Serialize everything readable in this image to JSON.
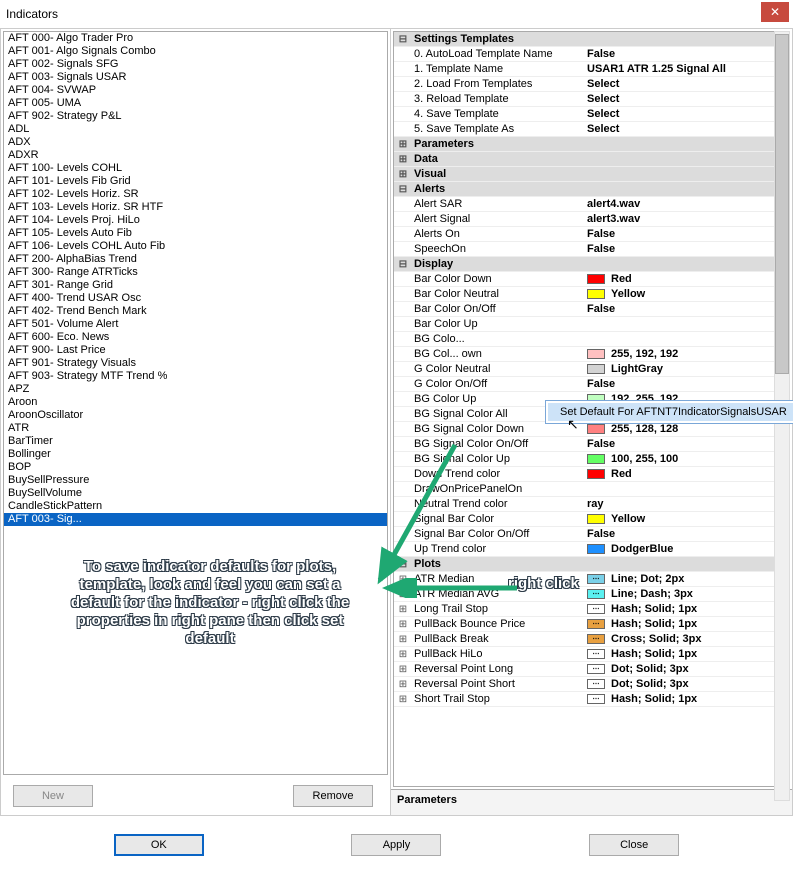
{
  "window": {
    "title": "Indicators",
    "close": "✕"
  },
  "indicators": [
    "AFT 000- Algo Trader Pro",
    "AFT 001- Algo Signals Combo",
    "AFT 002- Signals SFG",
    "AFT 003- Signals USAR",
    "AFT 004- SVWAP",
    "AFT 005- UMA",
    "AFT 902- Strategy P&L",
    "ADL",
    "ADX",
    "ADXR",
    "AFT 100- Levels COHL",
    "AFT 101- Levels Fib Grid",
    "AFT 102- Levels Horiz. SR",
    "AFT 103- Levels Horiz. SR HTF",
    "AFT 104- Levels Proj. HiLo",
    "AFT 105- Levels Auto Fib",
    "AFT 106- Levels COHL Auto Fib",
    "AFT 200- AlphaBias Trend",
    "AFT 300- Range ATRTicks",
    "AFT 301- Range Grid",
    "AFT 400- Trend USAR Osc",
    "AFT 402- Trend Bench Mark",
    "AFT 501- Volume Alert",
    "AFT 600- Eco. News",
    "AFT 900- Last Price",
    "AFT 901- Strategy Visuals",
    "AFT 903- Strategy MTF Trend %",
    "APZ",
    "Aroon",
    "AroonOscillator",
    "ATR",
    "BarTimer",
    "Bollinger",
    "BOP",
    "BuySellPressure",
    "BuySellVolume",
    "CandleStickPattern"
  ],
  "selected_indicator": "AFT 003- Sig...",
  "buttons": {
    "new": "New",
    "remove": "Remove",
    "ok": "OK",
    "apply": "Apply",
    "close": "Close"
  },
  "categories": {
    "settings_templates": "Settings Templates",
    "parameters": "Parameters",
    "data": "Data",
    "visual": "Visual",
    "alerts": "Alerts",
    "display": "Display",
    "plots": "Plots"
  },
  "templates": [
    {
      "label": "0. AutoLoad Template Name",
      "value": "False"
    },
    {
      "label": "1. Template Name",
      "value": "USAR1 ATR 1.25 Signal All"
    },
    {
      "label": "2. Load From Templates",
      "value": "Select"
    },
    {
      "label": "3. Reload Template",
      "value": "Select"
    },
    {
      "label": "4. Save Template",
      "value": "Select"
    },
    {
      "label": "5. Save Template As",
      "value": "Select"
    }
  ],
  "alerts": [
    {
      "label": "Alert SAR",
      "value": "alert4.wav"
    },
    {
      "label": "Alert Signal",
      "value": "alert3.wav"
    },
    {
      "label": "Alerts On",
      "value": "False"
    },
    {
      "label": "SpeechOn",
      "value": "False"
    }
  ],
  "display": [
    {
      "label": "Bar Color Down",
      "value": "Red",
      "swatch": "#ff0000"
    },
    {
      "label": "Bar Color Neutral",
      "value": "Yellow",
      "swatch": "#ffff00"
    },
    {
      "label": "Bar Color On/Off",
      "value": "False"
    },
    {
      "label": "Bar Color Up",
      "value": ""
    },
    {
      "label": "BG Colo...",
      "value": ""
    },
    {
      "label": "BG Col... own",
      "value": "255, 192, 192",
      "swatch": "#ffc0c0"
    },
    {
      "label": "G Color Neutral",
      "value": "LightGray",
      "swatch": "#d3d3d3"
    },
    {
      "label": "G Color On/Off",
      "value": "False"
    },
    {
      "label": "BG Color Up",
      "value": "192, 255, 192",
      "swatch": "#c0ffc0"
    },
    {
      "label": "BG Signal Color All",
      "value": "False"
    },
    {
      "label": "BG Signal Color Down",
      "value": "255, 128, 128",
      "swatch": "#ff8080"
    },
    {
      "label": "BG Signal Color On/Off",
      "value": "False"
    },
    {
      "label": "BG Signal Color Up",
      "value": "100, 255, 100",
      "swatch": "#64ff64"
    },
    {
      "label": "Down Trend color",
      "value": "Red",
      "swatch": "#ff0000"
    },
    {
      "label": "DrawOnPricePanelOn",
      "value": ""
    },
    {
      "label": "Neutral Trend color",
      "value": "ray"
    },
    {
      "label": "Signal Bar Color",
      "value": "Yellow",
      "swatch": "#ffff00"
    },
    {
      "label": "Signal Bar Color On/Off",
      "value": "False"
    },
    {
      "label": "Up Trend color",
      "value": "DodgerBlue",
      "swatch": "#1e90ff"
    }
  ],
  "plots": [
    {
      "label": "ATR Median",
      "value": "Line; Dot; 2px",
      "swatch": "#7ad0e8"
    },
    {
      "label": "ATR Median AVG",
      "value": "Line; Dash; 3px",
      "swatch": "#5af0f0"
    },
    {
      "label": "Long Trail Stop",
      "value": "Hash; Solid; 1px",
      "swatch": "#ffffff"
    },
    {
      "label": "PullBack Bounce Price",
      "value": "Hash; Solid; 1px",
      "swatch": "#e8a040"
    },
    {
      "label": "PullBack Break",
      "value": "Cross; Solid; 3px",
      "swatch": "#e8a040"
    },
    {
      "label": "PullBack HiLo",
      "value": "Hash; Solid; 1px",
      "swatch": "#ffffff"
    },
    {
      "label": "Reversal Point Long",
      "value": "Dot; Solid; 3px",
      "swatch": "#ffffff"
    },
    {
      "label": "Reversal Point Short",
      "value": "Dot; Solid; 3px",
      "swatch": "#ffffff"
    },
    {
      "label": "Short Trail Stop",
      "value": "Hash; Solid; 1px",
      "swatch": "#ffffff"
    }
  ],
  "desc_panel": "Parameters",
  "context_menu": "Set Default For AFTNT7IndicatorSignalsUSAR",
  "annotations": {
    "main": "To save indicator defaults for plots, template, look and feel you can set a default for the indicator - right click the properties in right pane then  click set default",
    "right": "right click"
  }
}
